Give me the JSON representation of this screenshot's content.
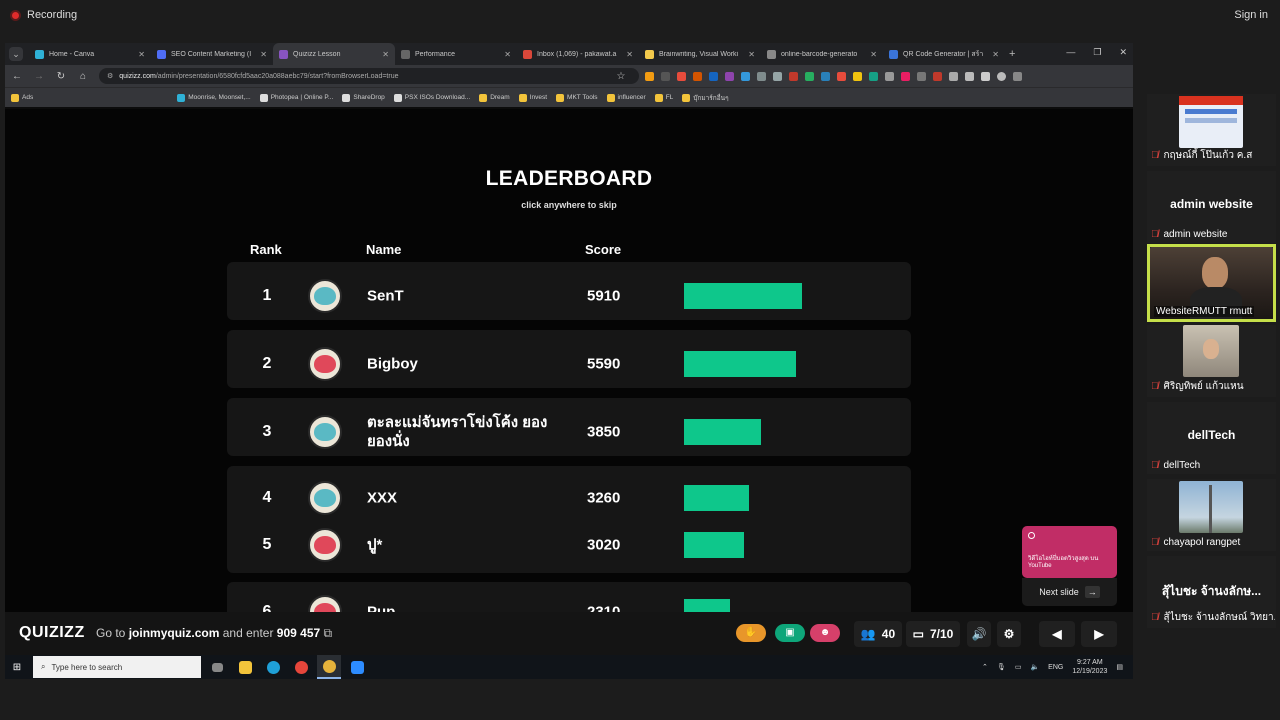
{
  "zoom": {
    "recording_label": "Recording",
    "signin_label": "Sign in"
  },
  "browser": {
    "tabs": [
      {
        "title": "Home - Canva",
        "color": "#2fb1d6"
      },
      {
        "title": "SEO Content Marketing (I",
        "color": "#4f6df5"
      },
      {
        "title": "Quizizz Lesson",
        "color": "#8854c0"
      },
      {
        "title": "Performance",
        "color": "#666666"
      },
      {
        "title": "Inbox (1,069) - pakawat.a",
        "color": "#d9473a"
      },
      {
        "title": "Brainwriting, Visual Worki",
        "color": "#f2c94c"
      },
      {
        "title": "online-barcode-generato",
        "color": "#888888"
      },
      {
        "title": "QR Code Generator | สร้า",
        "color": "#3a74d9"
      }
    ],
    "url_host": "quizizz.com",
    "url_path": "/admin/presentation/6580fcfd5aac20a088aebc79/start?fromBrowserLoad=true",
    "bookmarks": [
      "Ads",
      "Moonrise, Moonset,...",
      "Photopea | Online P...",
      "ShareDrop",
      "PSX ISOs Download...",
      "Dream",
      "Invest",
      "MKT Tools",
      "influencer",
      "FL",
      "บุ๊กมาร์กอื่นๆ"
    ]
  },
  "leaderboard": {
    "title": "LEADERBOARD",
    "subtitle": "click anywhere to skip",
    "col_rank": "Rank",
    "col_name": "Name",
    "col_score": "Score",
    "max_score": 5910,
    "entries": [
      {
        "rank": "1",
        "name": "SenT",
        "score": "5910",
        "value": 5910
      },
      {
        "rank": "2",
        "name": "Bigboy",
        "score": "5590",
        "value": 5590
      },
      {
        "rank": "3",
        "name": "ตะละแม่จันทราโข่งโค้ง ยองยองนั่ง",
        "score": "3850",
        "value": 3850
      },
      {
        "rank": "4",
        "name": "XXX",
        "score": "3260",
        "value": 3260
      },
      {
        "rank": "5",
        "name": "ปู*",
        "score": "3020",
        "value": 3020
      },
      {
        "rank": "6",
        "name": "Pup",
        "score": "2310",
        "value": 2310
      }
    ]
  },
  "quiz_bar": {
    "logo": "QUIZIZZ",
    "join_prefix": "Go to",
    "join_site": "joinmyquiz.com",
    "join_middle": "and enter",
    "join_code": "909 457",
    "participants": "40",
    "slide_counter": "7/10",
    "popup_text": "วิดีโอไฮท์ปี่บอดวิวสูงสุด บน YouTube",
    "next_slide_label": "Next slide"
  },
  "taskbar": {
    "search_placeholder": "Type here to search",
    "lang": "ENG",
    "time": "9:27 AM",
    "date": "12/19/2023"
  },
  "participants_panel": [
    {
      "name": "กฤษณ์กี้ โป๊นเก้ว ค.ส"
    },
    {
      "name": "admin website",
      "big": "admin website"
    },
    {
      "name": "WebsiteRMUTT rmutt"
    },
    {
      "name": "ศิริญทิพย์ แก้วแหน"
    },
    {
      "name": "dellTech",
      "big": "dellTech"
    },
    {
      "name": "chayapol rangpet"
    },
    {
      "name": "สุ้ไบชะ จ้านงลักษณ์ วิทยา...",
      "big": "สุ้ไบชะ จ้านงลักษ..."
    }
  ]
}
